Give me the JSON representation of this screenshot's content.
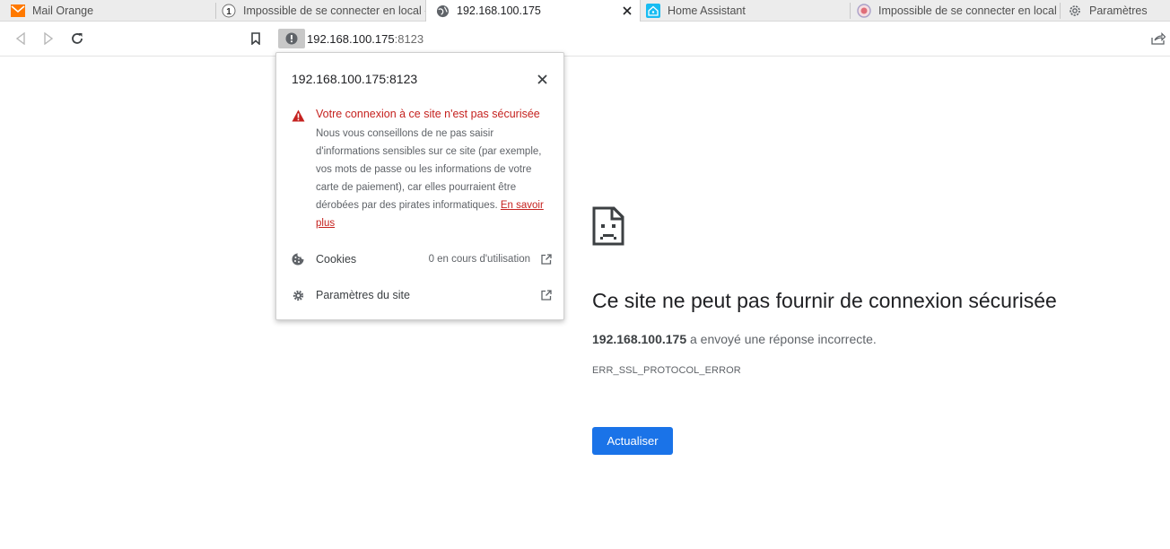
{
  "tabs": [
    {
      "title": "Mail Orange",
      "icon": "orange-mail-icon",
      "active": false
    },
    {
      "title": "Impossible de se connecter en local -",
      "icon": "badge-one-icon",
      "active": false
    },
    {
      "title": "192.168.100.175",
      "icon": "globe-icon",
      "active": true
    },
    {
      "title": "Home Assistant",
      "icon": "home-assistant-icon",
      "active": false
    },
    {
      "title": "Impossible de se connecter en local -",
      "icon": "forum-logo-icon",
      "active": false
    },
    {
      "title": "Paramètres",
      "icon": "gear-icon",
      "active": false
    }
  ],
  "badge_number": "1",
  "address": {
    "host": "192.168.100.175",
    "port": ":8123"
  },
  "popup": {
    "title": "192.168.100.175:8123",
    "warning_title": "Votre connexion à ce site n'est pas sécurisée",
    "warning_text": "Nous vous conseillons de ne pas saisir d'informations sensibles sur ce site (par exemple, vos mots de passe ou les informations de votre carte de paiement), car elles pourraient être dérobées par des pirates informatiques.",
    "learn_more": "En savoir plus",
    "cookies_label": "Cookies",
    "cookies_value": "0 en cours d'utilisation",
    "site_settings_label": "Paramètres du site"
  },
  "error": {
    "title": "Ce site ne peut pas fournir de connexion sécurisée",
    "host": "192.168.100.175",
    "message": "a envoyé une réponse incorrecte.",
    "code": "ERR_SSL_PROTOCOL_ERROR",
    "reload_label": "Actualiser"
  },
  "colors": {
    "accent_blue": "#1a73e8",
    "warning_red": "#c5221f",
    "orange_brand": "#ff7900",
    "home_assistant_blue": "#18bcf2"
  }
}
